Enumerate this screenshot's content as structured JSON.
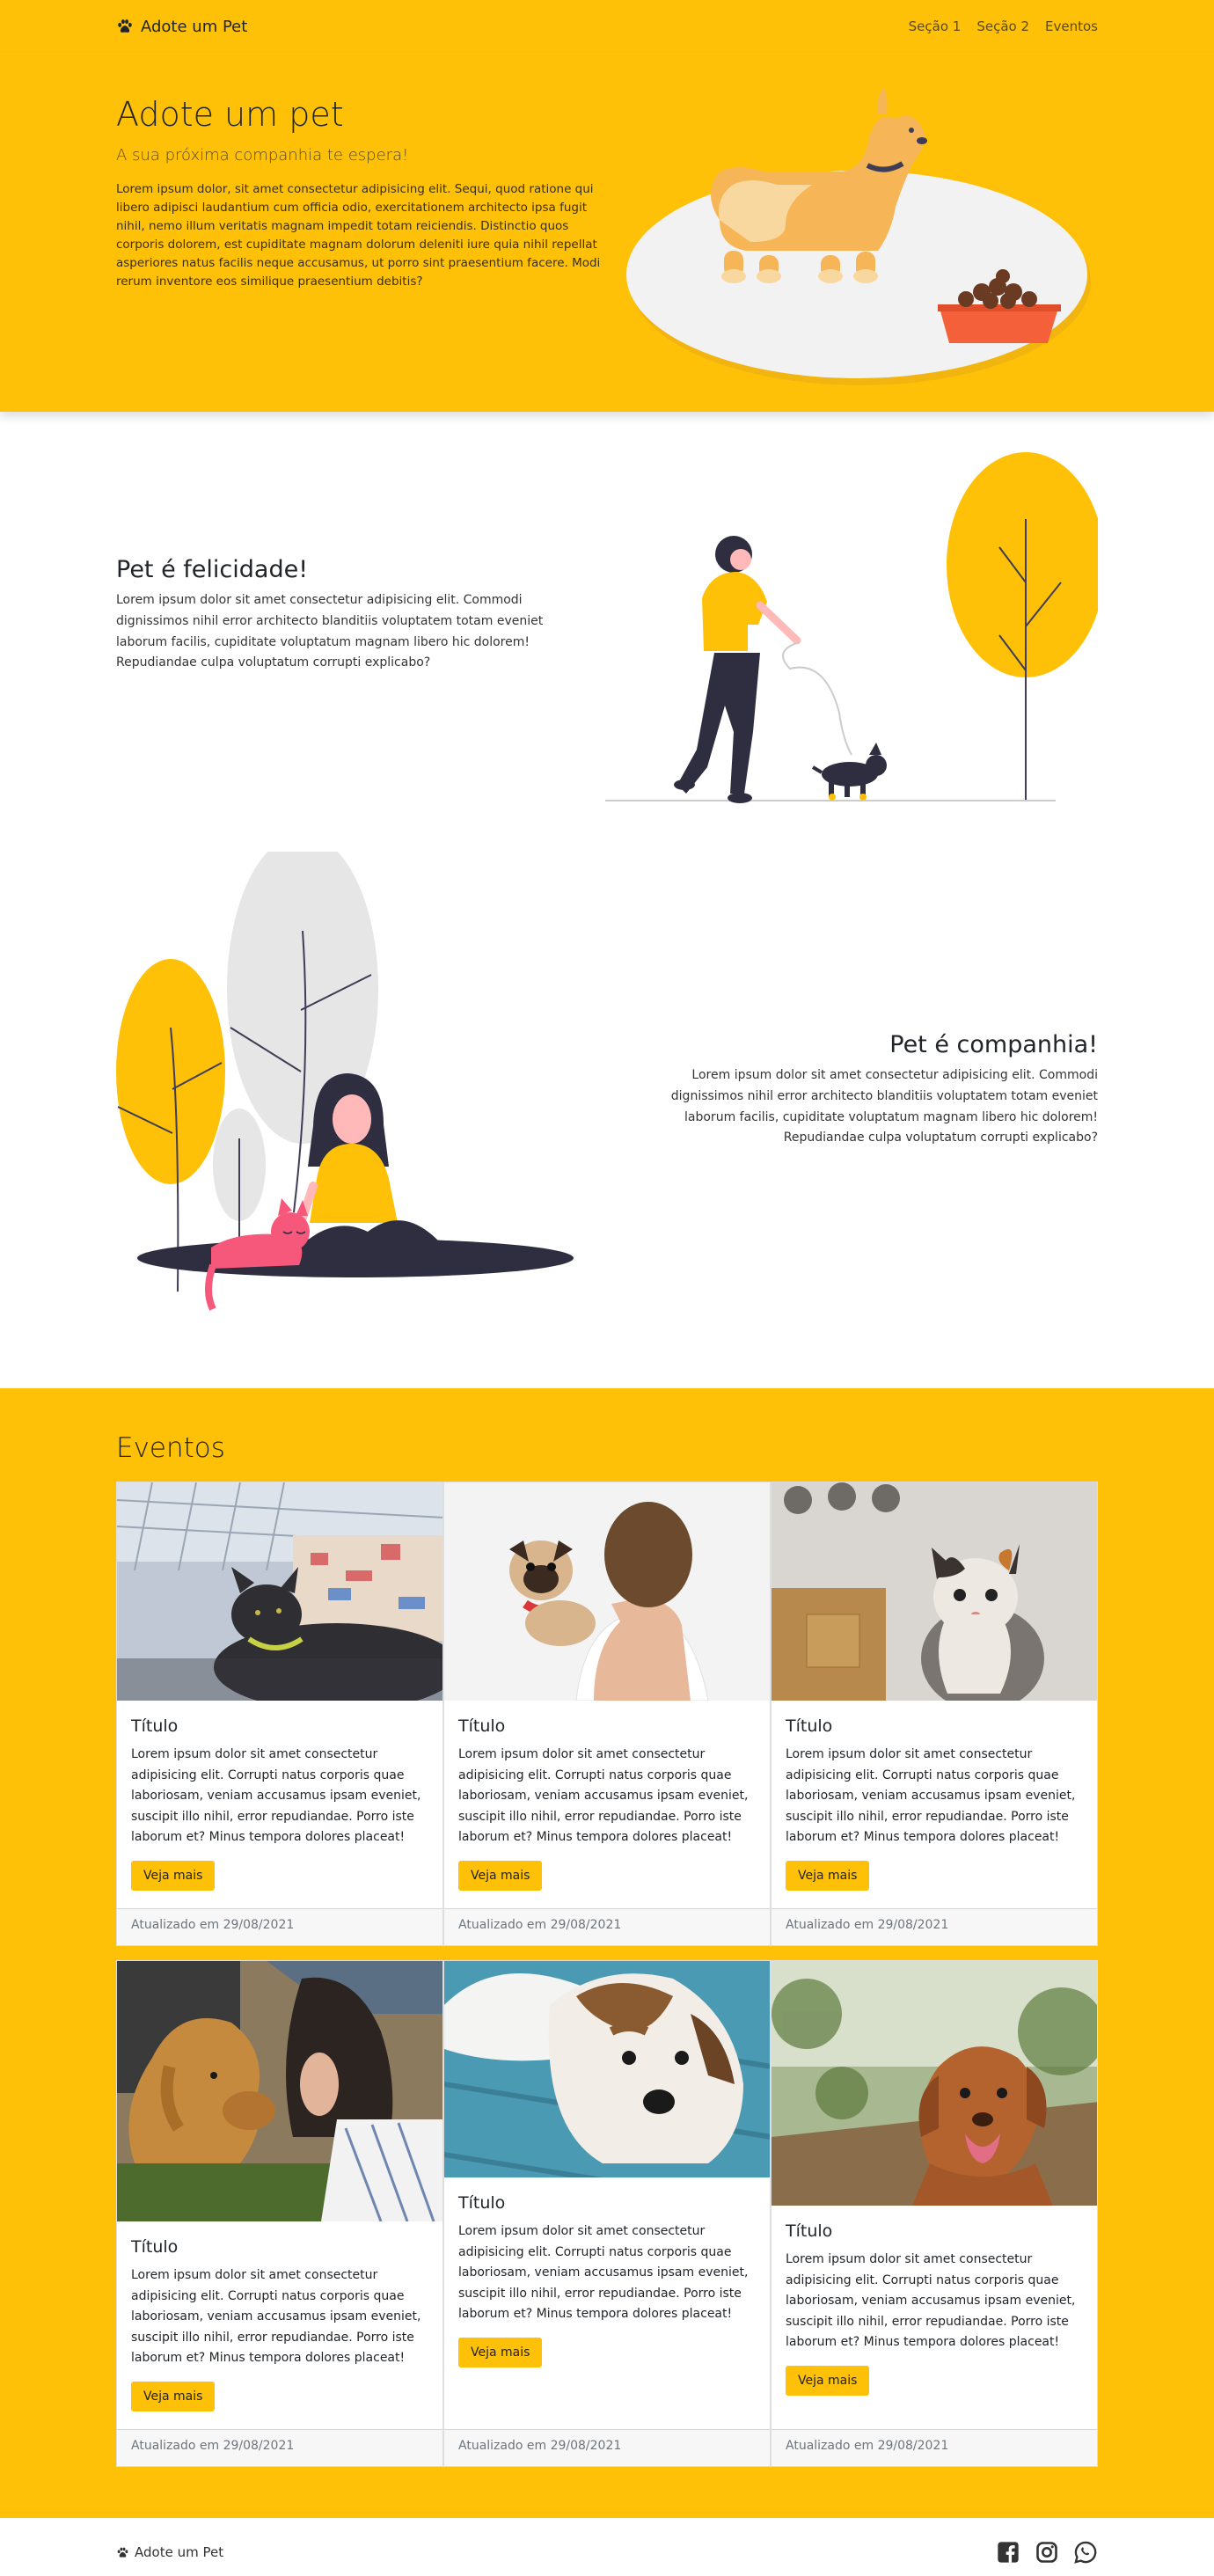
{
  "nav": {
    "brand": "Adote um Pet",
    "links": [
      "Seção 1",
      "Seção 2",
      "Eventos"
    ]
  },
  "hero": {
    "title": "Adote um pet",
    "subtitle": "A sua próxima companhia te espera!",
    "description": "Lorem ipsum dolor, sit amet consectetur adipisicing elit. Sequi, quod ratione qui libero adipisci laudantium cum officia odio, exercitationem architecto ipsa fugit nihil, nemo illum veritatis magnam impedit totam reiciendis. Distinctio quos corporis dolorem, est cupiditate magnam dolorum deleniti iure quia nihil repellat asperiores natus facilis neque accusamus, ut porro sint praesentium facere. Modi rerum inventore eos similique praesentium debitis?"
  },
  "features": [
    {
      "title": "Pet é felicidade!",
      "description": "Lorem ipsum dolor sit amet consectetur adipisicing elit. Commodi dignissimos nihil error architecto blanditiis voluptatem totam eveniet laborum facilis, cupiditate voluptatum magnam libero hic dolorem! Repudiandae culpa voluptatum corrupti explicabo?"
    },
    {
      "title": "Pet é companhia!",
      "description": "Lorem ipsum dolor sit amet consectetur adipisicing elit. Commodi dignissimos nihil error architecto blanditiis voluptatem totam eveniet laborum facilis, cupiditate voluptatum magnam libero hic dolorem! Repudiandae culpa voluptatum corrupti explicabo?"
    }
  ],
  "events": {
    "title": "Eventos",
    "cards": [
      {
        "title": "Título",
        "text": "Lorem ipsum dolor sit amet consectetur adipisicing elit. Corrupti natus corporis quae laboriosam, veniam accusamus ipsam eveniet, suscipit illo nihil, error repudiandae. Porro iste laborum et? Minus tempora dolores placeat!",
        "button": "Veja mais",
        "footer": "Atualizado em 29/08/2021",
        "image": "black-cat"
      },
      {
        "title": "Título",
        "text": "Lorem ipsum dolor sit amet consectetur adipisicing elit. Corrupti natus corporis quae laboriosam, veniam accusamus ipsam eveniet, suscipit illo nihil, error repudiandae. Porro iste laborum et? Minus tempora dolores placeat!",
        "button": "Veja mais",
        "footer": "Atualizado em 29/08/2021",
        "image": "boy-with-pug"
      },
      {
        "title": "Título",
        "text": "Lorem ipsum dolor sit amet consectetur adipisicing elit. Corrupti natus corporis quae laboriosam, veniam accusamus ipsam eveniet, suscipit illo nihil, error repudiandae. Porro iste laborum et? Minus tempora dolores placeat!",
        "button": "Veja mais",
        "footer": "Atualizado em 29/08/2021",
        "image": "calico-kitten"
      },
      {
        "title": "Título",
        "text": "Lorem ipsum dolor sit amet consectetur adipisicing elit. Corrupti natus corporis quae laboriosam, veniam accusamus ipsam eveniet, suscipit illo nihil, error repudiandae. Porro iste laborum et? Minus tempora dolores placeat!",
        "button": "Veja mais",
        "footer": "Atualizado em 29/08/2021",
        "image": "golden-retriever"
      },
      {
        "title": "Título",
        "text": "Lorem ipsum dolor sit amet consectetur adipisicing elit. Corrupti natus corporis quae laboriosam, veniam accusamus ipsam eveniet, suscipit illo nihil, error repudiandae. Porro iste laborum et? Minus tempora dolores placeat!",
        "button": "Veja mais",
        "footer": "Atualizado em 29/08/2021",
        "image": "terrier-on-bench"
      },
      {
        "title": "Título",
        "text": "Lorem ipsum dolor sit amet consectetur adipisicing elit. Corrupti natus corporis quae laboriosam, veniam accusamus ipsam eveniet, suscipit illo nihil, error repudiandae. Porro iste laborum et? Minus tempora dolores placeat!",
        "button": "Veja mais",
        "footer": "Atualizado em 29/08/2021",
        "image": "toller-dog"
      }
    ]
  },
  "footer": {
    "brand": "Adote um Pet",
    "social": [
      "facebook-icon",
      "instagram-icon",
      "whatsapp-icon"
    ]
  },
  "colors": {
    "brand_yellow": "#FFC107",
    "dark": "#3F3D56",
    "pink": "#F5587A"
  }
}
